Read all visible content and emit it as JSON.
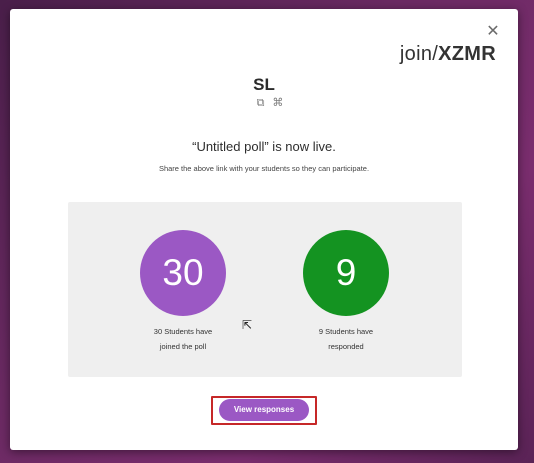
{
  "modal": {
    "close_icon": "close-icon",
    "join_prefix": "join/",
    "join_code": "XZMR",
    "name": "SL",
    "copy_icon": "copy-icon",
    "shortcut_icon": "command-icon",
    "live_text": "“Untitled poll” is now live.",
    "share_text": "Share the above link with your students so they can participate."
  },
  "stats": {
    "joined_count": "30",
    "joined_label_1": "30 Students have",
    "joined_label_2": "joined the poll",
    "responded_count": "9",
    "responded_label_1": "9 Students have",
    "responded_label_2": "responded"
  },
  "actions": {
    "view_responses_label": "View responses"
  },
  "colors": {
    "accent_purple": "#9b58c4",
    "accent_green": "#149321",
    "highlight_red": "#c62828"
  }
}
